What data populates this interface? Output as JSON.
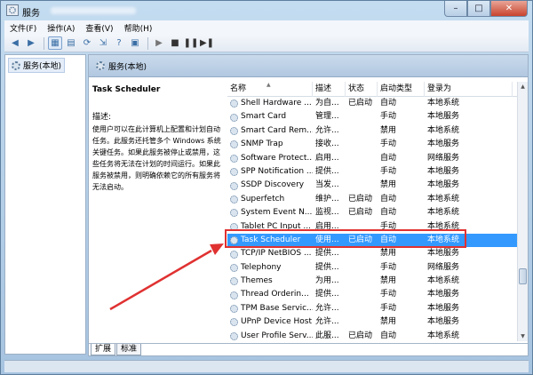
{
  "window": {
    "title": "服务",
    "buttons": {
      "minimize": "–",
      "maximize": "□",
      "close": "✕"
    }
  },
  "menu": [
    "文件(F)",
    "操作(A)",
    "查看(V)",
    "帮助(H)"
  ],
  "toolbar": [
    "back",
    "forward",
    "show-hide-tree",
    "properties",
    "refresh",
    "export",
    "help",
    "console",
    "play",
    "stop",
    "pause",
    "restart"
  ],
  "tree": {
    "root_label": "服务(本地)"
  },
  "header": {
    "title": "服务(本地)"
  },
  "detail": {
    "service_name": "Task Scheduler",
    "desc_label": "描述:",
    "desc_text": "使用户可以在此计算机上配置和计划自动任务。此服务还托管多个 Windows 系统关键任务。如果此服务被停止或禁用，这些任务将无法在计划的时间运行。如果此服务被禁用，则明确依赖它的所有服务将无法启动。"
  },
  "columns": [
    "名称",
    "描述",
    "状态",
    "启动类型",
    "登录为"
  ],
  "rows": [
    {
      "name": "Shell Hardware ...",
      "desc": "为自...",
      "status": "已启动",
      "start": "自动",
      "logon": "本地系统"
    },
    {
      "name": "Smart Card",
      "desc": "管理...",
      "status": "",
      "start": "手动",
      "logon": "本地服务"
    },
    {
      "name": "Smart Card Rem...",
      "desc": "允许...",
      "status": "",
      "start": "禁用",
      "logon": "本地系统"
    },
    {
      "name": "SNMP Trap",
      "desc": "接收...",
      "status": "",
      "start": "手动",
      "logon": "本地服务"
    },
    {
      "name": "Software Protect...",
      "desc": "启用...",
      "status": "",
      "start": "自动",
      "logon": "网络服务"
    },
    {
      "name": "SPP Notification ...",
      "desc": "提供...",
      "status": "",
      "start": "手动",
      "logon": "本地服务"
    },
    {
      "name": "SSDP Discovery",
      "desc": "当发...",
      "status": "",
      "start": "禁用",
      "logon": "本地服务"
    },
    {
      "name": "Superfetch",
      "desc": "维护...",
      "status": "已启动",
      "start": "自动",
      "logon": "本地系统"
    },
    {
      "name": "System Event N...",
      "desc": "监视...",
      "status": "已启动",
      "start": "自动",
      "logon": "本地系统"
    },
    {
      "name": "Tablet PC Input ...",
      "desc": "启用...",
      "status": "",
      "start": "手动",
      "logon": "本地系统"
    },
    {
      "name": "Task Scheduler",
      "desc": "使用...",
      "status": "已启动",
      "start": "自动",
      "logon": "本地系统",
      "selected": true
    },
    {
      "name": "TCP/IP NetBIOS ...",
      "desc": "提供...",
      "status": "",
      "start": "禁用",
      "logon": "本地服务"
    },
    {
      "name": "Telephony",
      "desc": "提供...",
      "status": "",
      "start": "手动",
      "logon": "网络服务"
    },
    {
      "name": "Themes",
      "desc": "为用...",
      "status": "",
      "start": "禁用",
      "logon": "本地系统"
    },
    {
      "name": "Thread Orderin...",
      "desc": "提供...",
      "status": "",
      "start": "手动",
      "logon": "本地服务"
    },
    {
      "name": "TPM Base Servic...",
      "desc": "允许...",
      "status": "",
      "start": "手动",
      "logon": "本地服务"
    },
    {
      "name": "UPnP Device Host",
      "desc": "允许...",
      "status": "",
      "start": "禁用",
      "logon": "本地服务"
    },
    {
      "name": "User Profile Serv...",
      "desc": "此服...",
      "status": "已启动",
      "start": "自动",
      "logon": "本地系统"
    }
  ],
  "tabs": [
    "扩展",
    "标准"
  ],
  "colors": {
    "selection": "#3399ff",
    "annotation": "#e03131"
  }
}
